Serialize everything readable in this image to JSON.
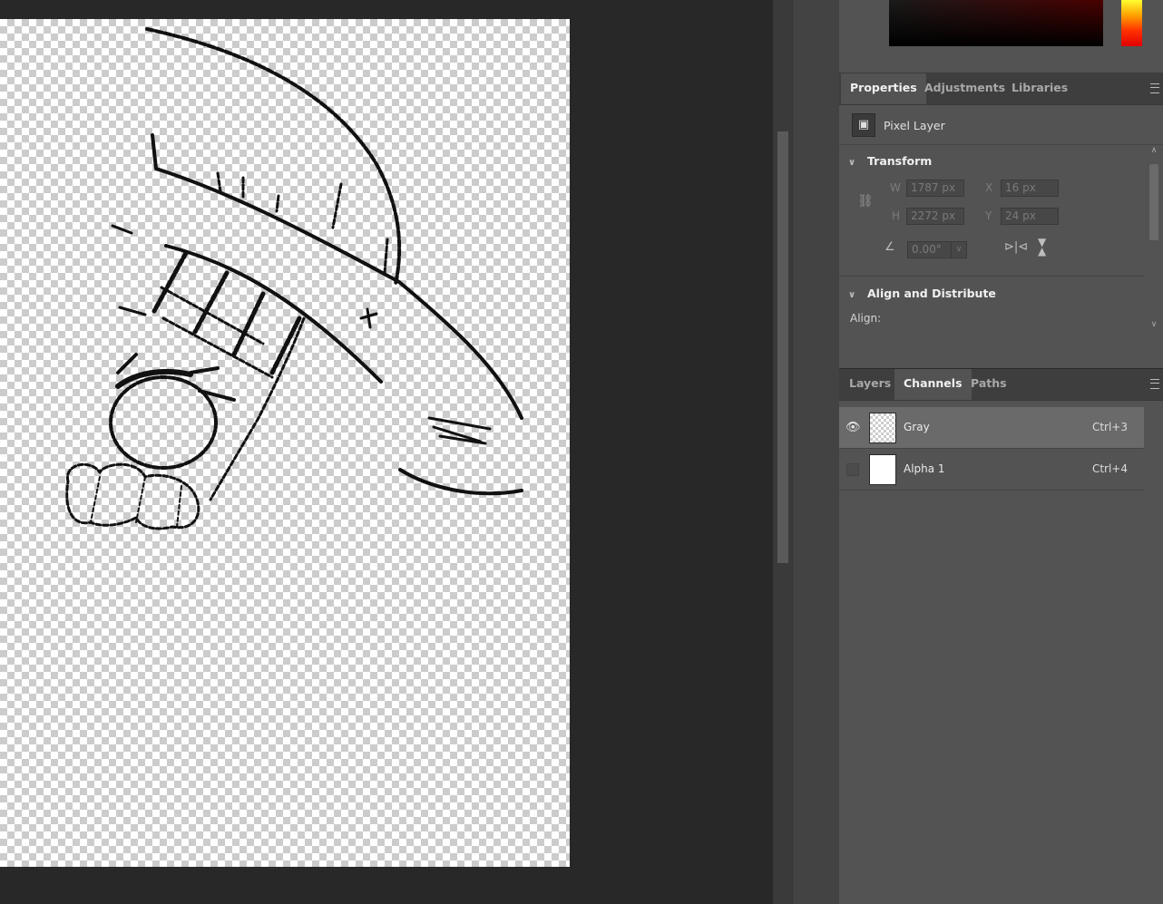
{
  "properties_panel": {
    "tabs": [
      {
        "label": "Properties",
        "active": true
      },
      {
        "label": "Adjustments",
        "active": false
      },
      {
        "label": "Libraries",
        "active": false
      }
    ],
    "layer_type": "Pixel Layer",
    "transform": {
      "heading": "Transform",
      "w_label": "W",
      "w_value": "1787 px",
      "h_label": "H",
      "h_value": "2272 px",
      "x_label": "X",
      "x_value": "16 px",
      "y_label": "Y",
      "y_value": "24 px",
      "angle_value": "0.00°"
    },
    "align": {
      "heading": "Align and Distribute",
      "label": "Align:"
    }
  },
  "channels_panel": {
    "tabs": [
      {
        "label": "Layers",
        "active": false
      },
      {
        "label": "Channels",
        "active": true
      },
      {
        "label": "Paths",
        "active": false
      }
    ],
    "rows": [
      {
        "name": "Gray",
        "shortcut": "Ctrl+3",
        "visible": true,
        "selected": true
      },
      {
        "name": "Alpha 1",
        "shortcut": "Ctrl+4",
        "visible": false,
        "selected": false
      }
    ]
  },
  "colors": {
    "app_bg": "#282828",
    "panel_bg": "#535353",
    "tabbar_bg": "#3e3e3e",
    "selected_row": "#6a6a6a"
  },
  "icons": {
    "layer_type": "image-icon",
    "link": "chain-link-icon",
    "angle": "angle-icon",
    "flip_h": "flip-horizontal-icon",
    "flip_v": "flip-vertical-icon",
    "visibility": "eye-icon",
    "menu": "panel-menu-icon"
  }
}
